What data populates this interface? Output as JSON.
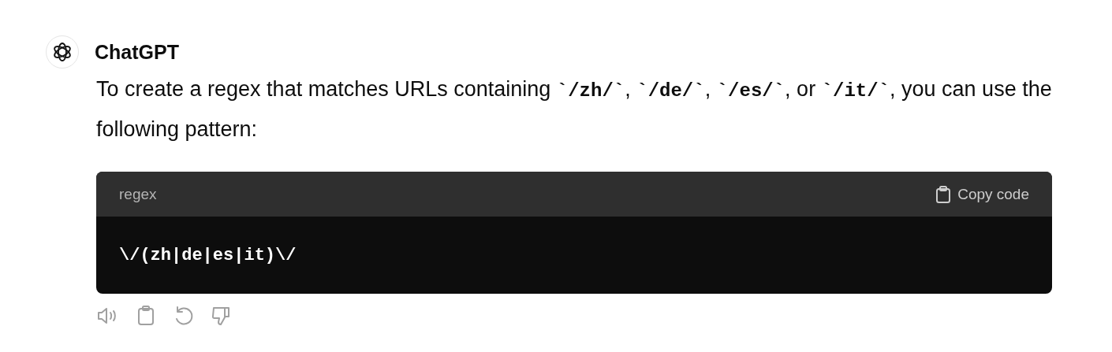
{
  "message": {
    "author": "ChatGPT",
    "paragraph": [
      {
        "kind": "text",
        "text": "To create a regex that matches URLs containing "
      },
      {
        "kind": "code",
        "text": "`/zh/`"
      },
      {
        "kind": "text",
        "text": ", "
      },
      {
        "kind": "code",
        "text": "`/de/`"
      },
      {
        "kind": "text",
        "text": ", "
      },
      {
        "kind": "code",
        "text": "`/es/`"
      },
      {
        "kind": "text",
        "text": ", or "
      },
      {
        "kind": "code",
        "text": "`/it/`"
      },
      {
        "kind": "text",
        "text": ", you can use the following pattern:"
      }
    ],
    "code_block": {
      "language": "regex",
      "copy_label": "Copy code",
      "code": "\\/(zh|de|es|it)\\/"
    },
    "actions": [
      {
        "kind": "speaker"
      },
      {
        "kind": "copy"
      },
      {
        "kind": "regenerate"
      },
      {
        "kind": "dislike"
      }
    ]
  }
}
